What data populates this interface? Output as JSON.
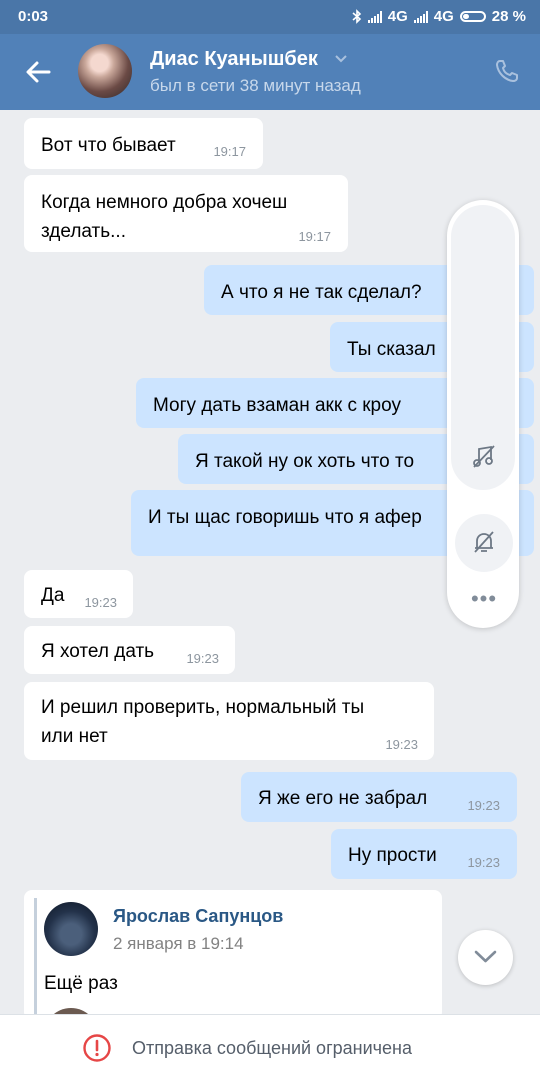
{
  "status_bar": {
    "time": "0:03",
    "network_1": "4G",
    "network_2": "4G",
    "battery": "28 %"
  },
  "header": {
    "contact_name": "Диас Куанышбек",
    "last_seen": "был в сети 38 минут назад",
    "back_icon": "arrow-left-icon",
    "call_icon": "phone-icon"
  },
  "messages": [
    {
      "dir": "in",
      "lines": [
        "Вот что бывает"
      ],
      "time": "19:17"
    },
    {
      "dir": "in",
      "lines": [
        "Когда немного добра хочеш",
        "зделать..."
      ],
      "time": "19:17"
    },
    {
      "dir": "out",
      "lines": [
        "А что я не так сделал?"
      ],
      "time": ""
    },
    {
      "dir": "out",
      "lines": [
        "Ты сказал"
      ],
      "time": ""
    },
    {
      "dir": "out",
      "lines": [
        "Могу дать взаман акк с кроу"
      ],
      "time": ""
    },
    {
      "dir": "out",
      "lines": [
        "Я такой ну ок хоть что то"
      ],
      "time": ""
    },
    {
      "dir": "out",
      "lines": [
        "И ты щас говоришь что я афер"
      ],
      "time": ""
    },
    {
      "dir": "in",
      "lines": [
        "Да"
      ],
      "time": "19:23"
    },
    {
      "dir": "in",
      "lines": [
        "Я хотел дать"
      ],
      "time": "19:23"
    },
    {
      "dir": "in",
      "lines": [
        "И решил проверить, нормальный ты",
        "или нет"
      ],
      "time": "19:23"
    },
    {
      "dir": "out",
      "lines": [
        "Я же его не забрал"
      ],
      "time": "19:23"
    },
    {
      "dir": "out",
      "lines": [
        "Ну прости"
      ],
      "time": "19:23"
    }
  ],
  "side_panel": {
    "music_icon": "music-off-icon",
    "bell_icon": "bell-off-icon",
    "more_icon": "more-dots-icon",
    "more_label": "•••"
  },
  "forwarded": {
    "author": "Ярослав Сапунцов",
    "date": "2 января в 19:14",
    "text": "Ещё раз"
  },
  "footer": {
    "text": "Отправка сообщений ограничена",
    "icon": "warning-circle-icon"
  },
  "colors": {
    "header": "#5181b8",
    "status_bar": "#4a76a8",
    "incoming_bubble": "#ffffff",
    "outgoing_bubble": "#cce4ff",
    "background": "#ebedf0",
    "warning": "#e64646"
  }
}
